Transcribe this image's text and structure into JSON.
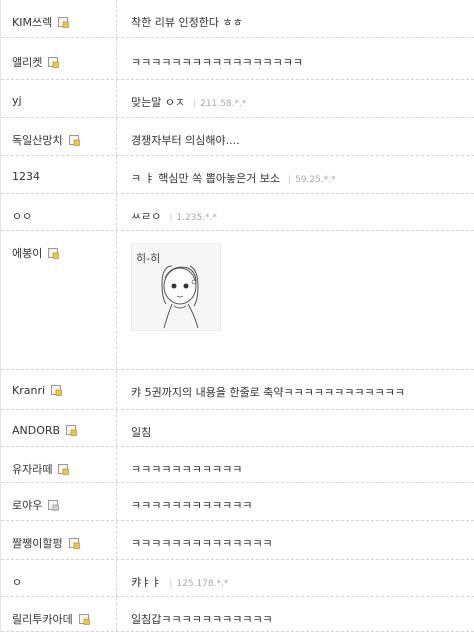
{
  "comments": [
    {
      "name": "KIM쓰렉",
      "text": "착한 리뷰 인정한다 ㅎㅎ",
      "ip": ""
    },
    {
      "name": "앨리켓",
      "text": "ㅋㅋㅋㅋㅋㅋㅋㅋㅋㅋㅋㅋㅋㅋㅋㅋㅋ",
      "ip": ""
    },
    {
      "name": "yj",
      "text": "맞는말 ㅇㅈ",
      "ip": "211.58.*.*"
    },
    {
      "name": "독일산망치",
      "text": "경쟁자부터 의심해야....",
      "ip": ""
    },
    {
      "name": "1234",
      "text": "ㅋ ㅑ 핵심만 쏙 뽑아놓은거 보소",
      "ip": "59.25.*.*"
    },
    {
      "name": "ㅇㅇ",
      "text": "ㅆㄹㅇ",
      "ip": "1.235.*.*"
    },
    {
      "name": "에봉이",
      "text": "",
      "ip": "",
      "drawing_text": "히-히"
    },
    {
      "name": "Kranri",
      "text": "캬 5권까지의 내용을 한줄로 축약ㅋㅋㅋㅋㅋㅋㅋㅋㅋㅋㅋㅋ",
      "ip": ""
    },
    {
      "name": "ANDORB",
      "text": "일침",
      "ip": ""
    },
    {
      "name": "유자라떼",
      "text": "ㅋㅋㅋㅋㅋㅋㅋㅋㅋㅋㅋ",
      "ip": ""
    },
    {
      "name": "로야우",
      "text": "ㅋㅋㅋㅋㅋㅋㅋㅋㅋㅋㅋㅋ",
      "ip": ""
    },
    {
      "name": "짤쨍이할펑",
      "text": "ㅋㅋㅋㅋㅋㅋㅋㅋㅋㅋㅋㅋㅋㅋ",
      "ip": ""
    },
    {
      "name": "ㅇ",
      "text": "캬ㅑㅑ",
      "ip": "125.178.*.*"
    },
    {
      "name": "릴리투카아데",
      "text": "일침갑ㅋㅋㅋㅋㅋㅋㅋㅋㅋㅋㅋ",
      "ip": ""
    }
  ],
  "ip_separator": "|",
  "colors": {
    "row_border": "#d6d6d6",
    "ip_text": "#a9a9a9",
    "badge": "#e8c84a"
  },
  "icons": {
    "member_badge": "lock-badge-icon"
  }
}
